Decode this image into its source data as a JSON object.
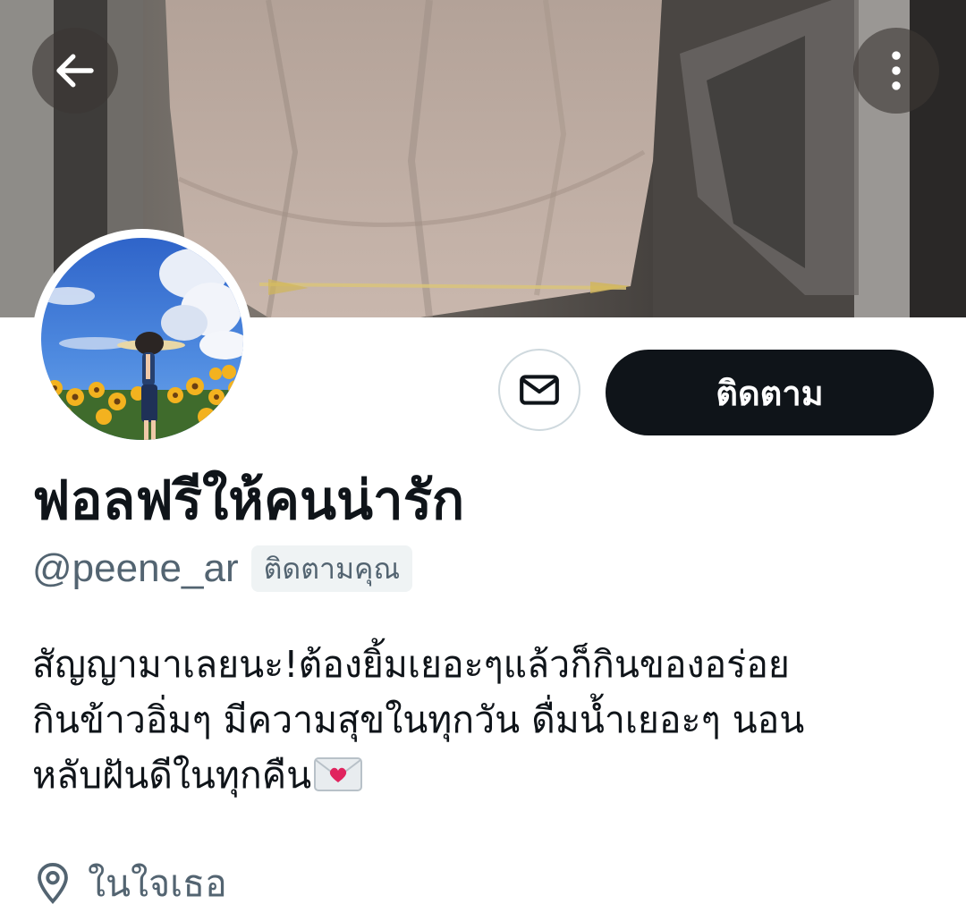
{
  "header": {
    "back_icon": "arrow-left-icon",
    "more_icon": "more-vertical-icon"
  },
  "actions": {
    "message_icon": "envelope-icon",
    "follow_label": "ติดตาม"
  },
  "profile": {
    "display_name": "ฟอลฟรีให้คนน่ารัก",
    "handle": "@peene_ar",
    "follows_you_badge": "ติดตามคุณ",
    "bio_lines": [
      "สัญญามาเลยนะ!ต้องยิ้มเยอะๆแล้วก็กินของอร่อย",
      "กินข้าวอิ่มๆ มีความสุขในทุกวัน ดื่มน้ำเยอะๆ นอน",
      "หลับฝันดีในทุกคืน"
    ],
    "bio_emoji": "love-letter-icon",
    "location_icon": "location-pin-icon",
    "location": "ในใจเธอ"
  },
  "colors": {
    "primary_text": "#0f1419",
    "secondary_text": "#536471",
    "follow_button_bg": "#0f1419",
    "badge_bg": "#eff3f4",
    "border": "#cfd9de"
  }
}
